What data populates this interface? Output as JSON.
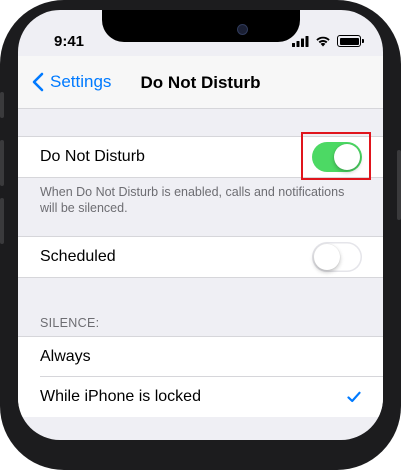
{
  "status_bar": {
    "time": "9:41",
    "icons": [
      "cellular-signal-icon",
      "wifi-icon",
      "battery-icon"
    ]
  },
  "nav": {
    "back_label": "Settings",
    "title": "Do Not Disturb"
  },
  "dnd_section": {
    "label": "Do Not Disturb",
    "toggle_on": true,
    "footer": "When Do Not Disturb is enabled, calls and notifications will be silenced."
  },
  "scheduled_section": {
    "label": "Scheduled",
    "toggle_on": false
  },
  "silence_section": {
    "header": "SILENCE:",
    "options": [
      {
        "label": "Always",
        "selected": false
      },
      {
        "label": "While iPhone is locked",
        "selected": true
      }
    ]
  },
  "colors": {
    "accent": "#007aff",
    "toggle_on": "#4cd964",
    "highlight": "#e0151d",
    "grouped_background": "#efeff4"
  }
}
